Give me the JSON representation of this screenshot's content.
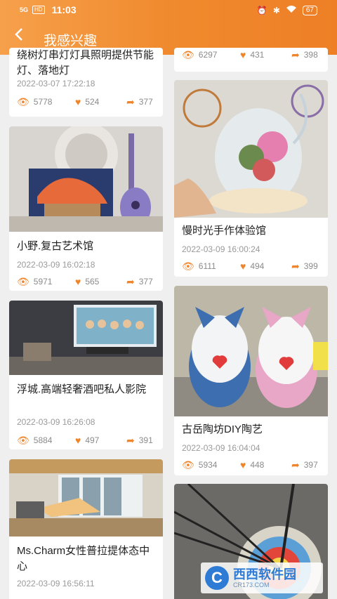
{
  "status": {
    "signal": "5G",
    "hd": "HD",
    "time": "11:03",
    "battery": "67"
  },
  "header": {
    "back": "<",
    "title": "我感兴趣"
  },
  "left_cards": [
    {
      "name": "绕树灯串灯灯具照明提供节能灯、落地灯",
      "date": "2022-03-07 17:22:18",
      "views": "5778",
      "likes": "524",
      "shares": "377"
    },
    {
      "name": "小野.复古艺术馆",
      "date": "2022-03-09 16:02:18",
      "views": "5971",
      "likes": "565",
      "shares": "377"
    },
    {
      "name": "浮城.高端轻奢酒吧私人影院",
      "date": "2022-03-09 16:26:08",
      "views": "5884",
      "likes": "497",
      "shares": "391"
    },
    {
      "name": "Ms.Charm女性普拉提体态中心",
      "date": "2022-03-09 16:56:11",
      "views": "",
      "likes": "",
      "shares": ""
    }
  ],
  "right_cards": [
    {
      "name": "",
      "date": "",
      "views": "6297",
      "likes": "431",
      "shares": "398"
    },
    {
      "name": "慢时光手作体验馆",
      "date": "2022-03-09 16:00:24",
      "views": "6111",
      "likes": "494",
      "shares": "399"
    },
    {
      "name": "古岳陶坊DIY陶艺",
      "date": "2022-03-09 16:04:04",
      "views": "5934",
      "likes": "448",
      "shares": "397"
    }
  ],
  "watermark": {
    "text": "西西软件园",
    "sub": "CR173.COM"
  }
}
